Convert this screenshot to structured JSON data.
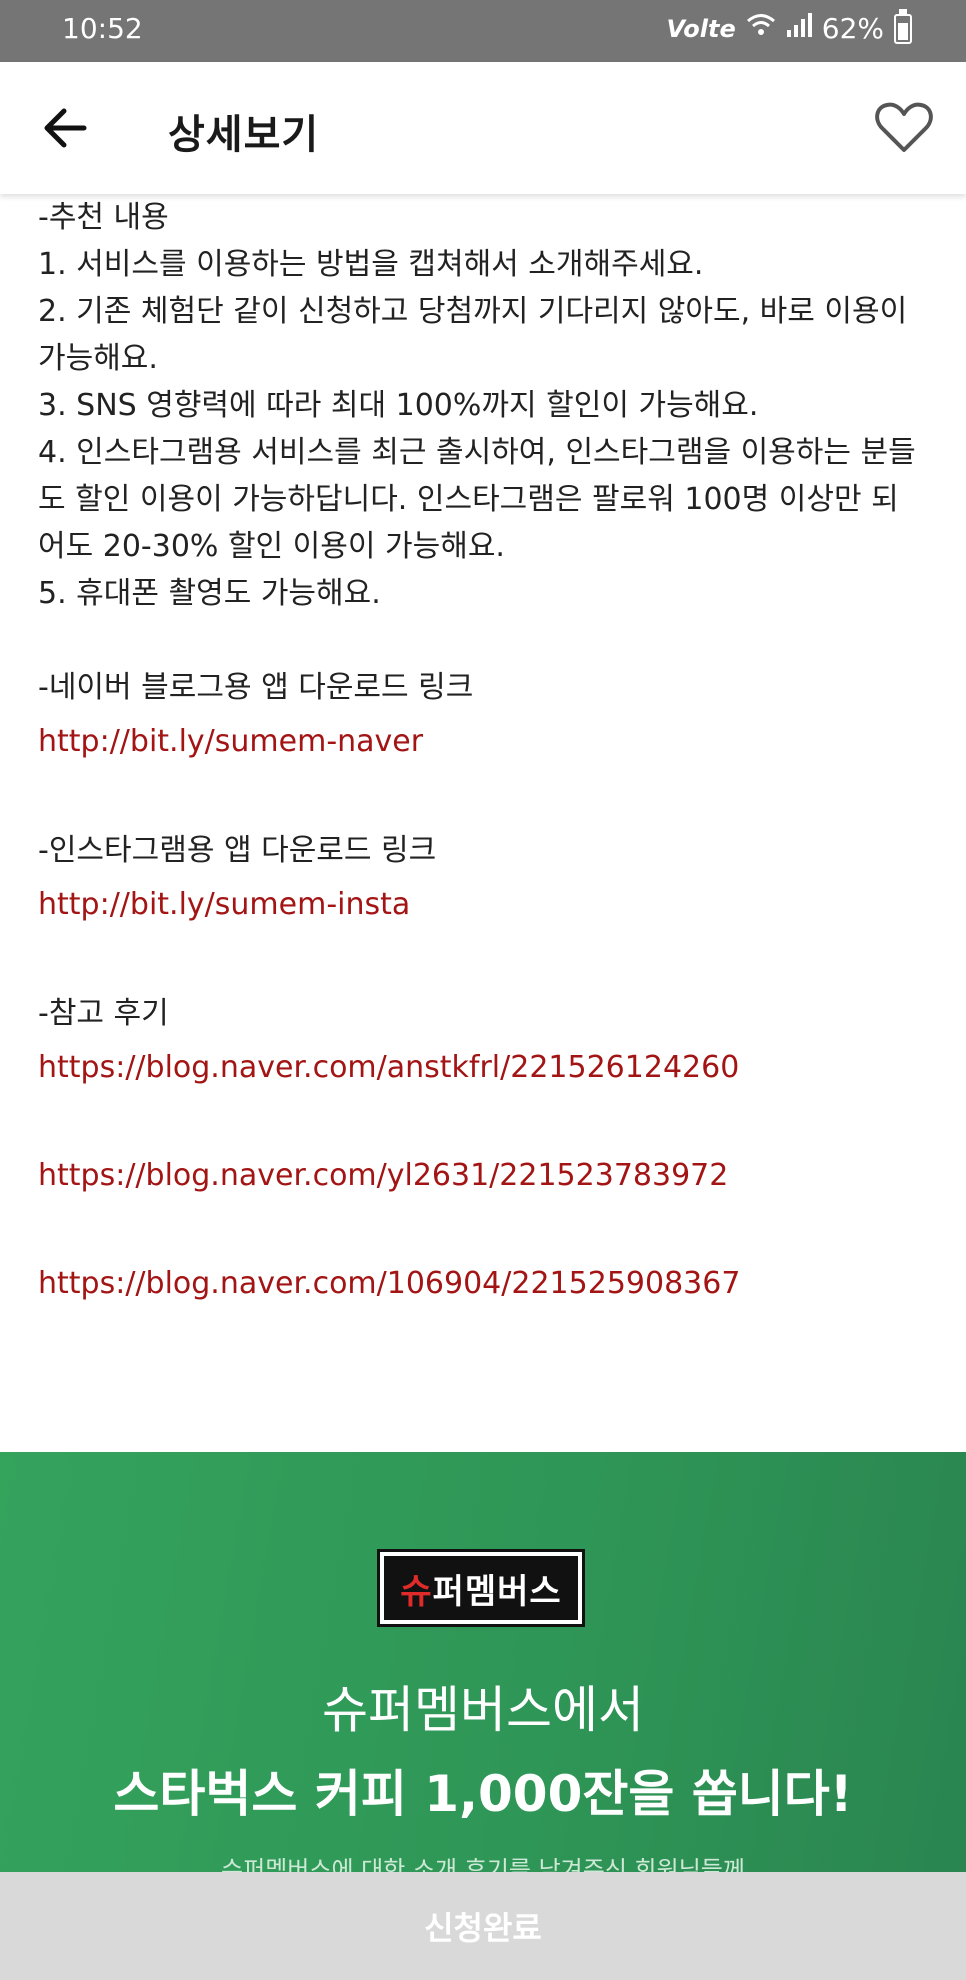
{
  "status_bar": {
    "time": "10:52",
    "network": "Volte",
    "battery": "62%",
    "icons": [
      "wifi-icon",
      "signal-icon",
      "battery-icon"
    ]
  },
  "header": {
    "title": "상세보기",
    "back_icon": "arrow-left-icon",
    "favorite_icon": "heart-outline-icon"
  },
  "content": {
    "recommend_heading": "-추천 내용",
    "recommend_items": [
      "1. 서비스를 이용하는 방법을 캡쳐해서 소개해주세요.",
      "2. 기존 체험단 같이 신청하고 당첨까지 기다리지 않아도, 바로 이용이 가능해요.",
      "3. SNS 영향력에 따라 최대 100%까지 할인이 가능해요.",
      "4. 인스타그램용 서비스를 최근 출시하여, 인스타그램을 이용하는 분들도 할인 이용이 가능하답니다. 인스타그램은 팔로워 100명 이상만 되어도 20-30% 할인 이용이 가능해요.",
      "5. 휴대폰 촬영도 가능해요."
    ],
    "naver_heading": "-네이버 블로그용 앱 다운로드 링크",
    "naver_link": "http://bit.ly/sumem-naver",
    "insta_heading": "-인스타그램용 앱 다운로드 링크",
    "insta_link": "http://bit.ly/sumem-insta",
    "review_heading": "-참고 후기",
    "review_links": [
      "https://blog.naver.com/anstkfrl/221526124260",
      "https://blog.naver.com/yl2631/221523783972",
      "https://blog.naver.com/106904/221525908367"
    ]
  },
  "banner": {
    "logo_text_red": "슈",
    "logo_text_white": "퍼멤버스",
    "line1": "슈퍼멤버스에서",
    "line2": "스타벅스 커피 1,000잔을 쏩니다!",
    "line3": "슈퍼멤버스에 대한 소개 후기를 남겨주신 회원님들께",
    "bg_color": "#2e9556"
  },
  "footer": {
    "apply_label": "신청완료",
    "apply_bg": "#d9d9d9"
  },
  "colors": {
    "link": "#a31515",
    "text": "#222222"
  }
}
